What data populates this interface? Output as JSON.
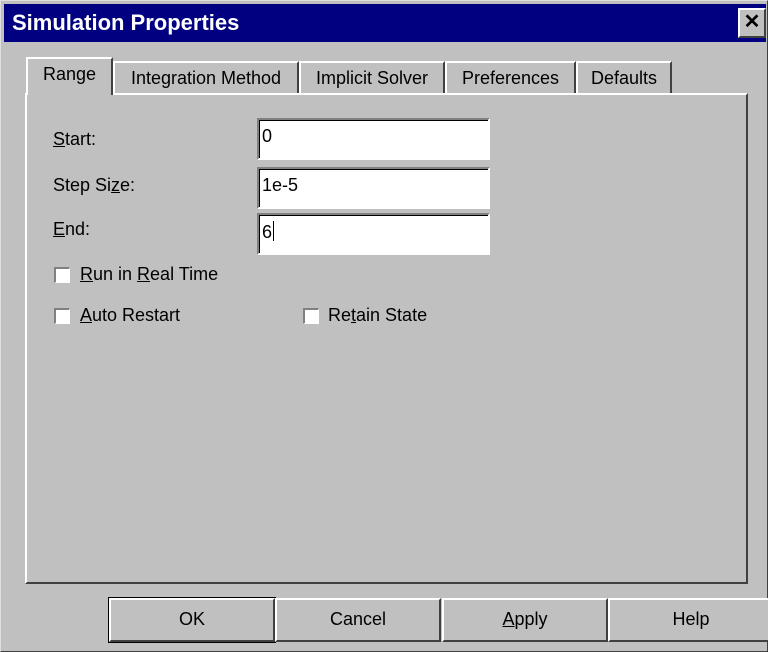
{
  "window": {
    "title": "Simulation Properties",
    "close_glyph": "✕"
  },
  "tabs": [
    {
      "label": "Range",
      "active": true
    },
    {
      "label": "Integration Method",
      "active": false
    },
    {
      "label": "Implicit Solver",
      "active": false
    },
    {
      "label": "Preferences",
      "active": false
    },
    {
      "label": "Defaults",
      "active": false
    }
  ],
  "range": {
    "start": {
      "label": "Start:",
      "value": "0"
    },
    "step_size": {
      "label": "Step Size:",
      "value": "1e-5"
    },
    "end": {
      "label": "End:",
      "value": "6"
    },
    "run_in_real_time": {
      "label": "Run in Real Time",
      "checked": false
    },
    "auto_restart": {
      "label": "Auto Restart",
      "checked": false
    },
    "retain_state": {
      "label": "Retain State",
      "checked": false
    }
  },
  "buttons": {
    "ok": "OK",
    "cancel": "Cancel",
    "apply": "Apply",
    "help": "Help"
  },
  "colors": {
    "titlebar": "#000080",
    "face": "#c0c0c0"
  }
}
